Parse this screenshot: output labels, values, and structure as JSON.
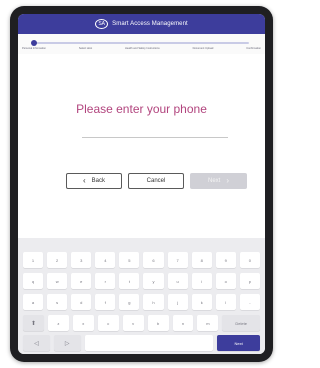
{
  "header": {
    "logo_text": "SA",
    "title": "Smart Access Management"
  },
  "progress": {
    "steps": [
      "Personal Information",
      "Select Host",
      "Health and Safety Instructions",
      "Document Upload",
      "Confirmation"
    ],
    "current_step": 1,
    "fill_fraction": 0.0
  },
  "prompt": "Please enter your phone",
  "phone_field": {
    "value": "",
    "placeholder": ""
  },
  "buttons": {
    "back": "Back",
    "cancel": "Cancel",
    "next": "Next"
  },
  "keyboard": {
    "row1": [
      "1",
      "2",
      "3",
      "4",
      "5",
      "6",
      "7",
      "8",
      "9",
      "0"
    ],
    "row2": [
      "q",
      "w",
      "e",
      "r",
      "t",
      "y",
      "u",
      "i",
      "o",
      "p"
    ],
    "row3": [
      "a",
      "s",
      "d",
      "f",
      "g",
      "h",
      "j",
      "k",
      "l",
      "-"
    ],
    "row4": [
      "z",
      "x",
      "c",
      "v",
      "b",
      "n",
      "m"
    ],
    "shift": "⬆",
    "delete": "Delete",
    "left": "◁",
    "right": "▷",
    "next": "Next"
  },
  "colors": {
    "brand": "#3d3d9c",
    "prompt": "#b2457e",
    "disabled": "#d0d0d6"
  }
}
